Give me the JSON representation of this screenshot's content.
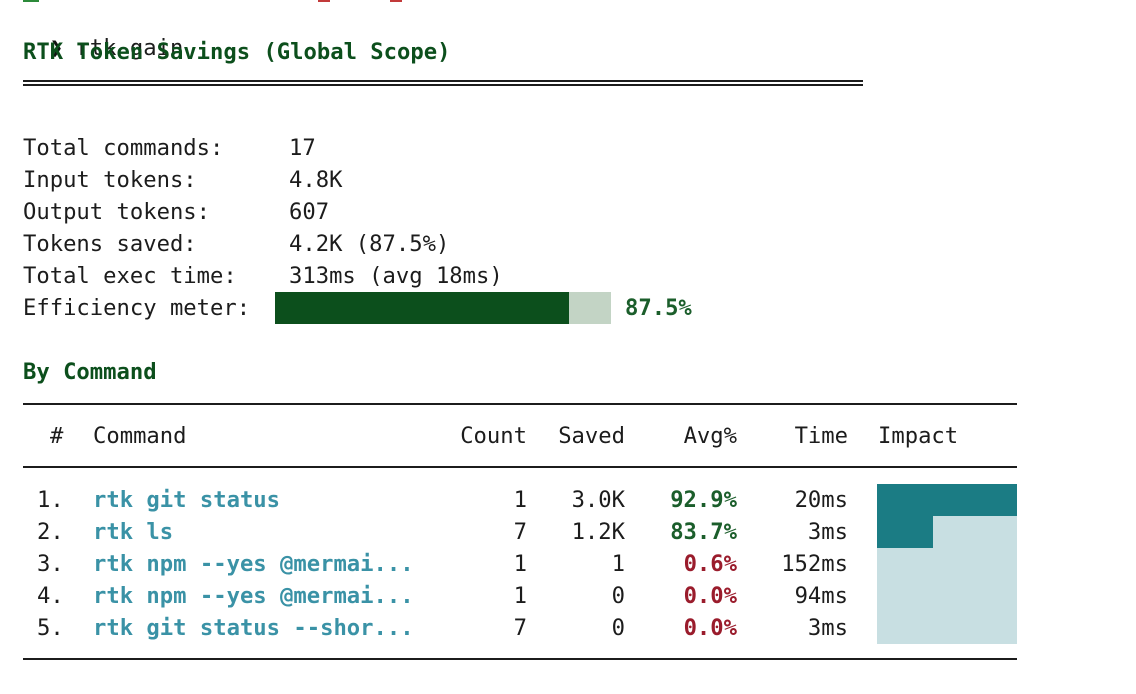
{
  "prompt": {
    "glyph": "❯",
    "command": "rtk gain"
  },
  "title": "RTK Token Savings (Global Scope)",
  "summary": [
    {
      "label": "Total commands:",
      "value": "17"
    },
    {
      "label": "Input tokens:",
      "value": "4.8K"
    },
    {
      "label": "Output tokens:",
      "value": "607"
    },
    {
      "label": "Tokens saved:",
      "value": "4.2K (87.5%)"
    },
    {
      "label": "Total exec time:",
      "value": "313ms (avg 18ms)"
    }
  ],
  "efficiency": {
    "label": "Efficiency meter:",
    "percent_text": "87.5%",
    "fraction": 0.875
  },
  "by_command": {
    "heading": "By Command",
    "headers": {
      "num": "#",
      "command": "Command",
      "count": "Count",
      "saved": "Saved",
      "avg": "Avg%",
      "time": "Time",
      "impact": "Impact"
    },
    "rows": [
      {
        "num": "1.",
        "command": "rtk git status",
        "count": "1",
        "saved": "3.0K",
        "avg": "92.9%",
        "avg_good": true,
        "time": "20ms",
        "impact": 1.0
      },
      {
        "num": "2.",
        "command": "rtk ls",
        "count": "7",
        "saved": "1.2K",
        "avg": "83.7%",
        "avg_good": true,
        "time": "3ms",
        "impact": 0.4
      },
      {
        "num": "3.",
        "command": "rtk npm --yes @mermai...",
        "count": "1",
        "saved": "1",
        "avg": "0.6%",
        "avg_good": false,
        "time": "152ms",
        "impact": 0.0
      },
      {
        "num": "4.",
        "command": "rtk npm --yes @mermai...",
        "count": "1",
        "saved": "0",
        "avg": "0.0%",
        "avg_good": false,
        "time": "94ms",
        "impact": 0.0
      },
      {
        "num": "5.",
        "command": "rtk git status --shor...",
        "count": "7",
        "saved": "0",
        "avg": "0.0%",
        "avg_good": false,
        "time": "3ms",
        "impact": 0.0
      }
    ]
  },
  "colors": {
    "accent_green": "#0c4f1c",
    "command_teal": "#3a92a6",
    "bad_red": "#9a1c2c",
    "impact_fill": "#1b7c84",
    "impact_track": "#c8dfe2"
  }
}
